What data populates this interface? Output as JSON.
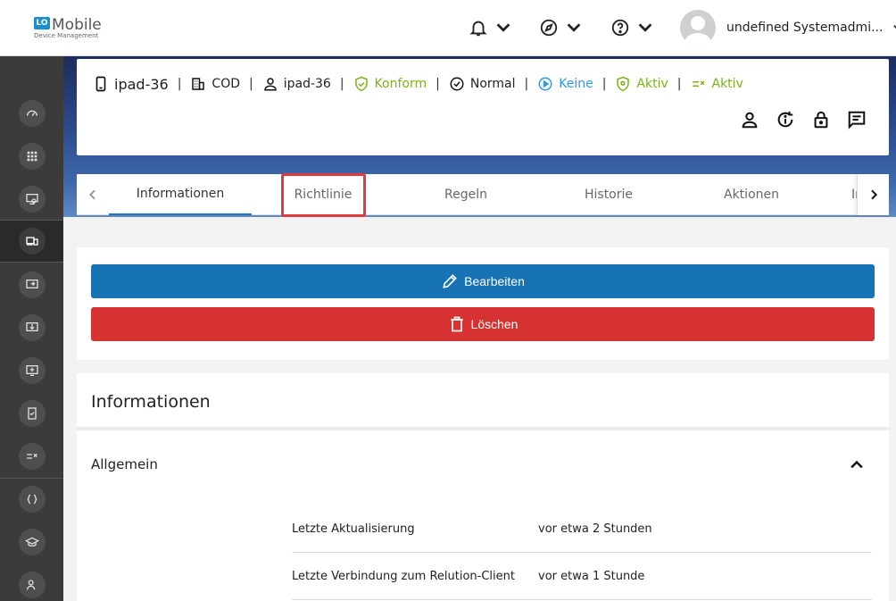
{
  "header": {
    "logo_badge": "LO",
    "logo_title": "Mobile",
    "logo_subtitle": "Device Management",
    "user_name": "undefined Systemadmi...",
    "icons": [
      "bell-icon",
      "compass-icon",
      "help-icon"
    ]
  },
  "sidebar": {
    "items": [
      {
        "icon": "dashboard-icon"
      },
      {
        "icon": "apps-grid-icon"
      },
      {
        "icon": "monitor-settings-icon"
      },
      {
        "icon": "devices-icon",
        "active": true
      },
      {
        "icon": "enroll-device-icon"
      },
      {
        "icon": "download-icon"
      },
      {
        "icon": "add-screen-icon"
      },
      {
        "icon": "compliance-icon"
      },
      {
        "icon": "rules-icon"
      },
      {
        "icon": "code-icon"
      },
      {
        "icon": "education-icon"
      },
      {
        "icon": "users-icon"
      }
    ]
  },
  "device": {
    "name": "ipad-36",
    "ownership": "COD",
    "user": "ipad-36",
    "compliance": "Konform",
    "state": "Normal",
    "lost_mode": "Keine",
    "protection": "Aktiv",
    "policy": "Aktiv",
    "colors": {
      "green": "#7ab317",
      "blue": "#2f9ae0"
    }
  },
  "tabs": {
    "items": [
      "Informationen",
      "Richtlinie",
      "Regeln",
      "Historie",
      "Aktionen",
      "In"
    ],
    "active": "Informationen",
    "highlighted": "Richtlinie"
  },
  "actions": {
    "edit_label": "Bearbeiten",
    "delete_label": "Löschen",
    "edit_color": "#1873b4",
    "delete_color": "#d63232"
  },
  "info": {
    "title": "Informationen",
    "section": "Allgemein",
    "rows": [
      {
        "label": "Letzte Aktualisierung",
        "value": "vor etwa 2 Stunden"
      },
      {
        "label": "Letzte Verbindung zum Relution-Client",
        "value": "vor etwa 1 Stunde"
      }
    ]
  }
}
